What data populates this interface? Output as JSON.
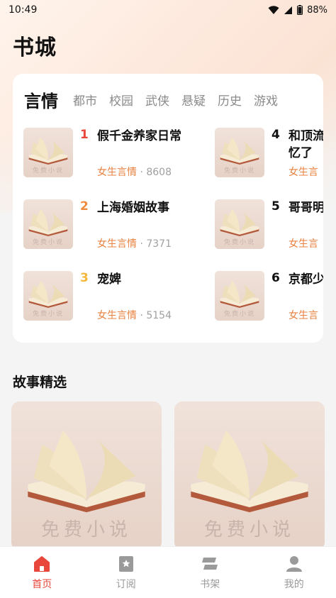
{
  "status_bar": {
    "time": "10:49",
    "battery": "88%",
    "icons": [
      "wifi-icon",
      "signal-icon",
      "battery-icon"
    ]
  },
  "page_title": "书城",
  "categories": [
    {
      "label": "言情",
      "active": true
    },
    {
      "label": "都市",
      "active": false
    },
    {
      "label": "校园",
      "active": false
    },
    {
      "label": "武侠",
      "active": false
    },
    {
      "label": "悬疑",
      "active": false
    },
    {
      "label": "历史",
      "active": false
    },
    {
      "label": "游戏",
      "active": false
    }
  ],
  "rank_list": [
    {
      "rank": "1",
      "title": "假千金养家日常",
      "genre": "女生言情",
      "sep": "·",
      "count": "8608",
      "rank_color": "#e9473b"
    },
    {
      "rank": "2",
      "title": "上海婚姻故事",
      "genre": "女生言情",
      "sep": "·",
      "count": "7371",
      "rank_color": "#f08a3c"
    },
    {
      "rank": "3",
      "title": "宠婢",
      "genre": "女生言情",
      "sep": "·",
      "count": "5154",
      "rank_color": "#f4b73a"
    },
    {
      "rank": "4",
      "title": "和顶流",
      "title_line2": "忆了",
      "genre": "女生言",
      "sep": "",
      "count": "",
      "rank_color": "#111111"
    },
    {
      "rank": "5",
      "title": "哥哥明",
      "genre": "女生言",
      "sep": "",
      "count": "",
      "rank_color": "#111111"
    },
    {
      "rank": "6",
      "title": "京都少",
      "genre": "女生言",
      "sep": "",
      "count": "",
      "rank_color": "#111111"
    }
  ],
  "cover_watermark": "免费小说",
  "section": {
    "title": "故事精选"
  },
  "bottom_nav": [
    {
      "label": "首页",
      "icon": "home-icon",
      "active": true
    },
    {
      "label": "订阅",
      "icon": "bookmark-icon",
      "active": false
    },
    {
      "label": "书架",
      "icon": "bookshelf-icon",
      "active": false
    },
    {
      "label": "我的",
      "icon": "profile-icon",
      "active": false
    }
  ],
  "colors": {
    "accent": "#e9473b",
    "genre": "#e8813f",
    "rank_1": "#e9473b",
    "rank_2": "#f08a3c",
    "rank_3": "#f4b73a"
  }
}
